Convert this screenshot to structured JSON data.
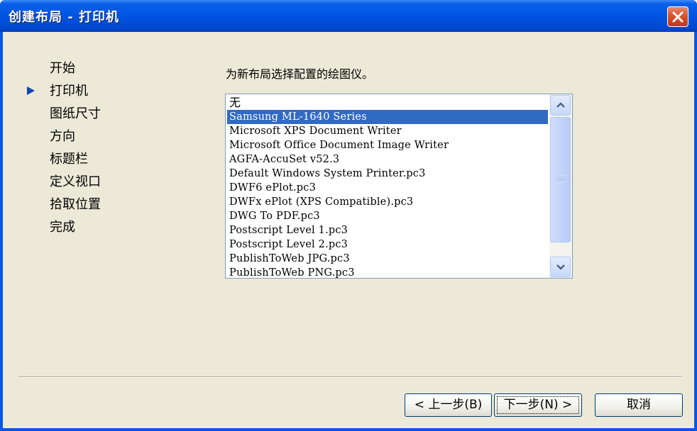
{
  "window": {
    "title": "创建布局 - 打印机",
    "close_icon": "close-icon"
  },
  "steps": [
    {
      "label": "开始",
      "current": false
    },
    {
      "label": "打印机",
      "current": true
    },
    {
      "label": "图纸尺寸",
      "current": false
    },
    {
      "label": "方向",
      "current": false
    },
    {
      "label": "标题栏",
      "current": false
    },
    {
      "label": "定义视口",
      "current": false
    },
    {
      "label": "拾取位置",
      "current": false
    },
    {
      "label": "完成",
      "current": false
    }
  ],
  "instruction": "为新布局选择配置的绘图仪。",
  "printer_list": {
    "selected": "Samsung ML-1640 Series",
    "items": [
      "无",
      "Samsung ML-1640 Series",
      "Microsoft XPS Document Writer",
      "Microsoft Office Document Image Writer",
      "AGFA-AccuSet v52.3",
      "Default Windows System Printer.pc3",
      "DWF6 ePlot.pc3",
      "DWFx ePlot (XPS Compatible).pc3",
      "DWG To PDF.pc3",
      "Postscript Level 1.pc3",
      "Postscript Level 2.pc3",
      "PublishToWeb JPG.pc3",
      "PublishToWeb PNG.pc3"
    ]
  },
  "buttons": {
    "back": "< 上一步(B)",
    "next": "下一步(N) >",
    "cancel": "取消"
  },
  "colors": {
    "title_bar": "#0054e3",
    "dialog_background": "#ece9d8",
    "selection": "#316ac5",
    "close_button": "#d7532f"
  }
}
